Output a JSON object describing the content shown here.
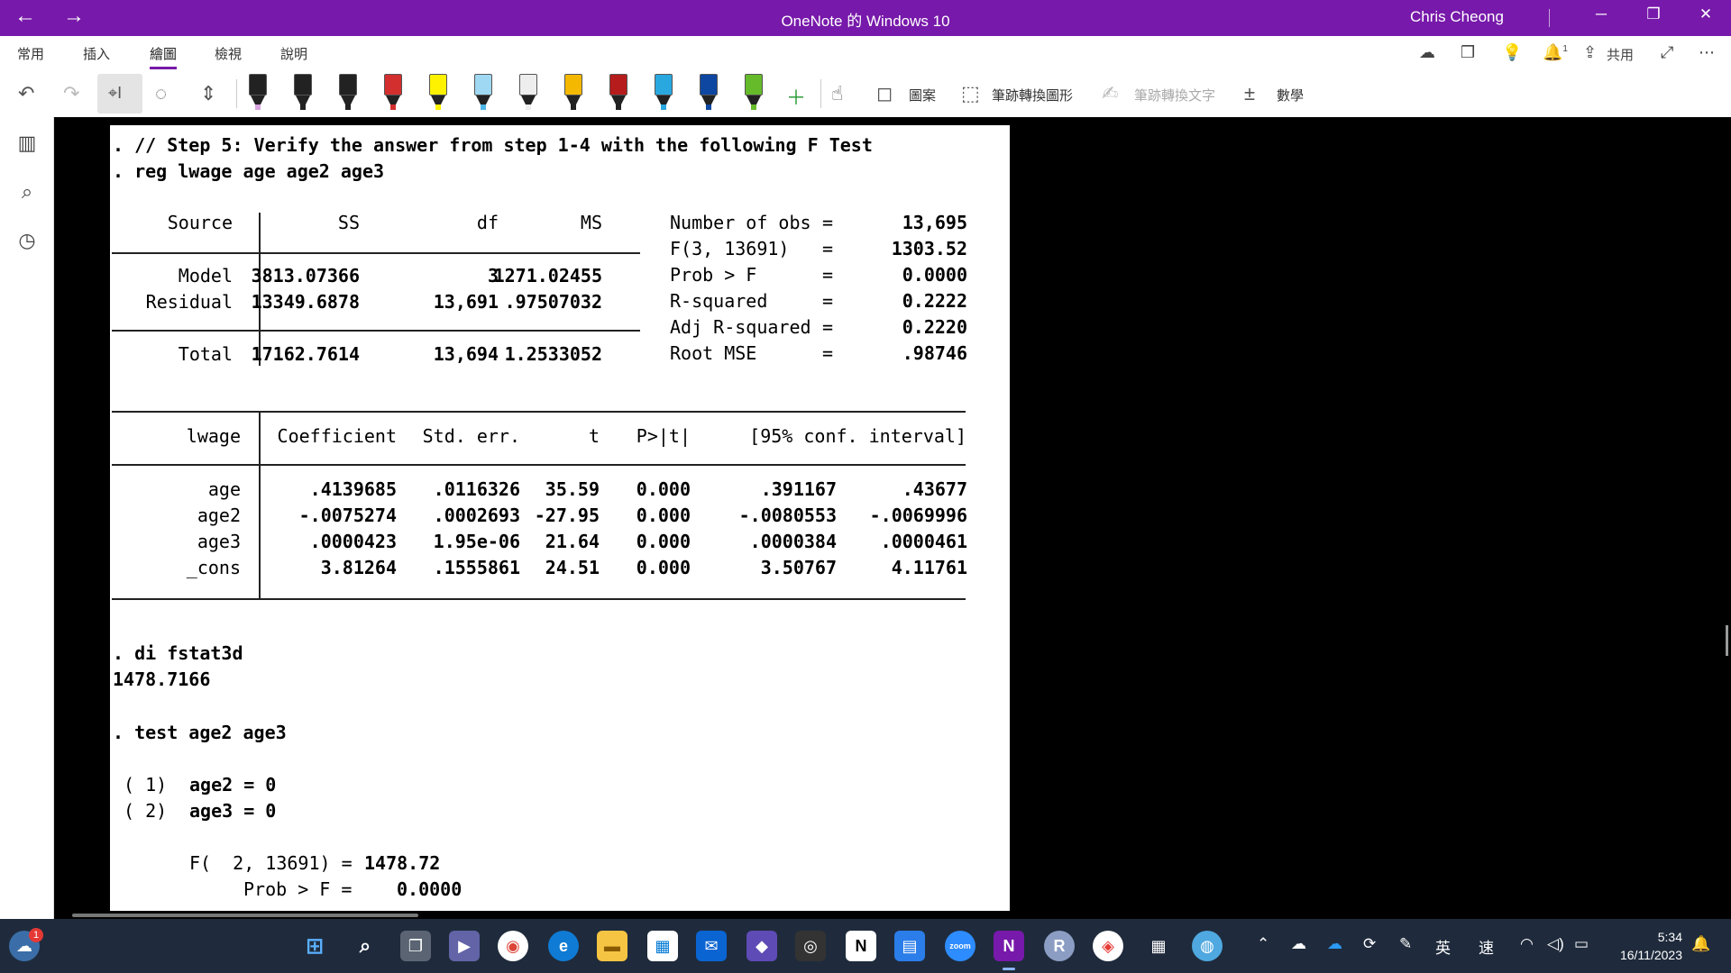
{
  "titlebar": {
    "title": "OneNote 的 Windows 10",
    "user": "Chris Cheong",
    "back": "←",
    "forward": "→",
    "minimize": "─",
    "restore": "❐",
    "close": "✕"
  },
  "ribbon_tabs": [
    "常用",
    "插入",
    "繪圖",
    "檢視",
    "說明"
  ],
  "ribbon_right": {
    "share_label": "共用",
    "notification_count": "1"
  },
  "toolbar": {
    "shapes_label": "圖案",
    "ink_to_shape_label": "筆跡轉換圖形",
    "ink_to_text_label": "筆跡轉換文字",
    "math_label": "數學",
    "pens": [
      {
        "body": "#222",
        "ink": "#d9a3e0"
      },
      {
        "body": "#222",
        "ink": "#222"
      },
      {
        "body": "#222",
        "ink": "#222"
      },
      {
        "body": "#d32f2f",
        "ink": "#d32f2f"
      },
      {
        "body": "#fff200",
        "ink": "#fff200"
      },
      {
        "body": "#9fd8f2",
        "ink": "#4fb6e8"
      },
      {
        "body": "#eee",
        "ink": "#eee"
      },
      {
        "body": "#f5b800",
        "ink": "#222"
      },
      {
        "body": "#b71c1c",
        "ink": "#222"
      },
      {
        "body": "#29a8e0",
        "ink": "#29a8e0"
      },
      {
        "body": "#0d47a1",
        "ink": "#0d47a1"
      },
      {
        "body": "#66bb2a",
        "ink": "#66bb2a"
      }
    ]
  },
  "stata": {
    "cmd1": ". // Step 5: Verify the answer from step 1-4 with the following F Test",
    "cmd2": ". reg lwage age age2 age3",
    "anova_headers": {
      "source": "Source",
      "ss": "SS",
      "df": "df",
      "ms": "MS"
    },
    "anova_rows": [
      {
        "label": "Model",
        "ss": "3813.07366",
        "df": "3",
        "ms": "1271.02455"
      },
      {
        "label": "Residual",
        "ss": "13349.6878",
        "df": "13,691",
        "ms": ".97507032"
      },
      {
        "label": "Total",
        "ss": "17162.7614",
        "df": "13,694",
        "ms": "1.2533052"
      }
    ],
    "stats": [
      {
        "label": "Number of obs",
        "eq": "=",
        "value": "13,695"
      },
      {
        "label": "F(3, 13691)",
        "eq": "=",
        "value": "1303.52"
      },
      {
        "label": "Prob > F",
        "eq": "=",
        "value": "0.0000"
      },
      {
        "label": "R-squared",
        "eq": "=",
        "value": "0.2222"
      },
      {
        "label": "Adj R-squared",
        "eq": "=",
        "value": "0.2220"
      },
      {
        "label": "Root MSE",
        "eq": "=",
        "value": ".98746"
      }
    ],
    "coef_headers": {
      "var": "lwage",
      "coef": "Coefficient",
      "se": "Std. err.",
      "t": "t",
      "p": "P>|t|",
      "ci": "[95% conf. interval]"
    },
    "coef_rows": [
      {
        "var": "age",
        "coef": ".4139685",
        "se": ".0116326",
        "t": "35.59",
        "p": "0.000",
        "lo": ".391167",
        "hi": ".43677"
      },
      {
        "var": "age2",
        "coef": "-.0075274",
        "se": ".0002693",
        "t": "-27.95",
        "p": "0.000",
        "lo": "-.0080553",
        "hi": "-.0069996"
      },
      {
        "var": "age3",
        "coef": ".0000423",
        "se": "1.95e-06",
        "t": "21.64",
        "p": "0.000",
        "lo": ".0000384",
        "hi": ".0000461"
      },
      {
        "var": "_cons",
        "coef": "3.81264",
        "se": ".1555861",
        "t": "24.51",
        "p": "0.000",
        "lo": "3.50767",
        "hi": "4.11761"
      }
    ],
    "cmd3": ". di fstat3d",
    "result3": "1478.7166",
    "cmd4": ". test age2 age3",
    "constraint1_num": "( 1)",
    "constraint1": "age2 = 0",
    "constraint2_num": "( 2)",
    "constraint2": "age3 = 0",
    "ftest_label": "F(  2, 13691) =",
    "ftest_value": "1478.72",
    "prob_label": "Prob > F =",
    "prob_value": "0.0000"
  },
  "taskbar": {
    "weather_badge": "1",
    "lang": "英",
    "ime": "速",
    "time": "5:34",
    "date": "16/11/2023"
  }
}
